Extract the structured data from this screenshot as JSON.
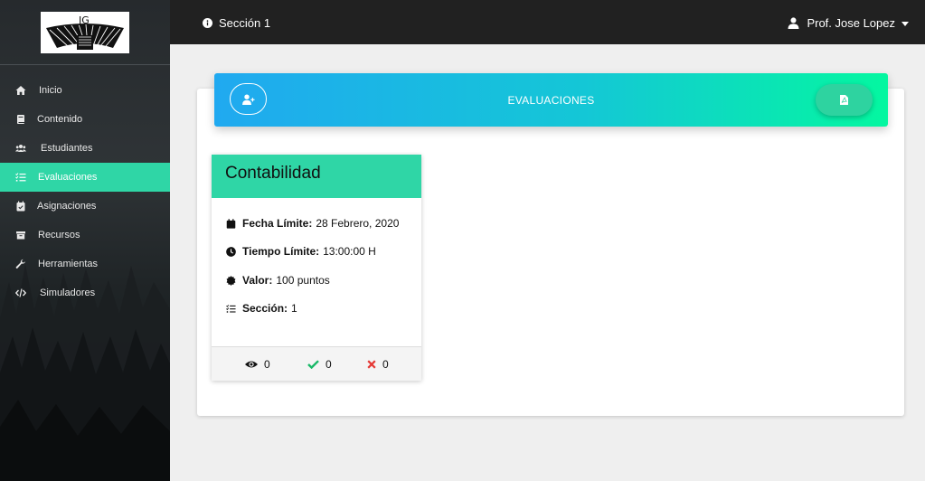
{
  "sidebar": {
    "items": [
      {
        "label": "Inicio",
        "icon": "home-icon",
        "active": false
      },
      {
        "label": "Contenido",
        "icon": "book-icon",
        "active": false
      },
      {
        "label": "Estudiantes",
        "icon": "users-icon",
        "active": false
      },
      {
        "label": "Evaluaciones",
        "icon": "tasks-icon",
        "active": true
      },
      {
        "label": "Asignaciones",
        "icon": "calendar-check-icon",
        "active": false
      },
      {
        "label": "Recursos",
        "icon": "archive-icon",
        "active": false
      },
      {
        "label": "Herramientas",
        "icon": "wrench-icon",
        "active": false
      },
      {
        "label": "Simuladores",
        "icon": "code-icon",
        "active": false
      }
    ]
  },
  "topbar": {
    "section_label": "Sección 1",
    "user_name": "Prof. Jose Lopez"
  },
  "banner": {
    "title": "EVALUACIONES"
  },
  "evaluation": {
    "title": "Contabilidad",
    "fields": [
      {
        "key": "Fecha Límite:",
        "value": "28 Febrero, 2020",
        "icon": "calendar-icon"
      },
      {
        "key": "Tiempo Límite:",
        "value": "13:00:00 H",
        "icon": "clock-icon"
      },
      {
        "key": "Valor:",
        "value": "100 puntos",
        "icon": "certificate-icon"
      },
      {
        "key": "Sección:",
        "value": "1",
        "icon": "list-icon"
      }
    ],
    "stats": {
      "viewed": "0",
      "approved": "0",
      "rejected": "0"
    }
  },
  "colors": {
    "accent": "#2fd6a6",
    "topbar": "#212121",
    "banner_start": "#20a9f0",
    "banner_end": "#04f7a0",
    "check": "#17b866",
    "cross": "#e53935"
  }
}
